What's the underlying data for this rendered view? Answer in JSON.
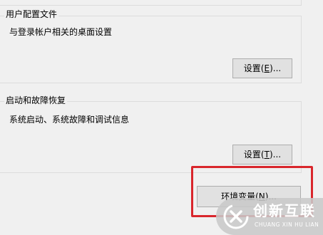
{
  "user_profiles": {
    "title": "用户配置文件",
    "description": "与登录帐户相关的桌面设置",
    "button": {
      "text": "设置(",
      "mnemonic": "E",
      "suffix": ")..."
    }
  },
  "startup_recovery": {
    "title": "启动和故障恢复",
    "description": "系统启动、系统故障和调试信息",
    "button": {
      "text": "设置(",
      "mnemonic": "T",
      "suffix": ")..."
    }
  },
  "environment": {
    "button": {
      "text": "环境变量(",
      "mnemonic": "N",
      "suffix": ")..."
    }
  },
  "highlight_color": "#d9262c",
  "watermark": {
    "brand_cn": "创新互联",
    "brand_en": "CHUANG XIN HU LIAN"
  }
}
